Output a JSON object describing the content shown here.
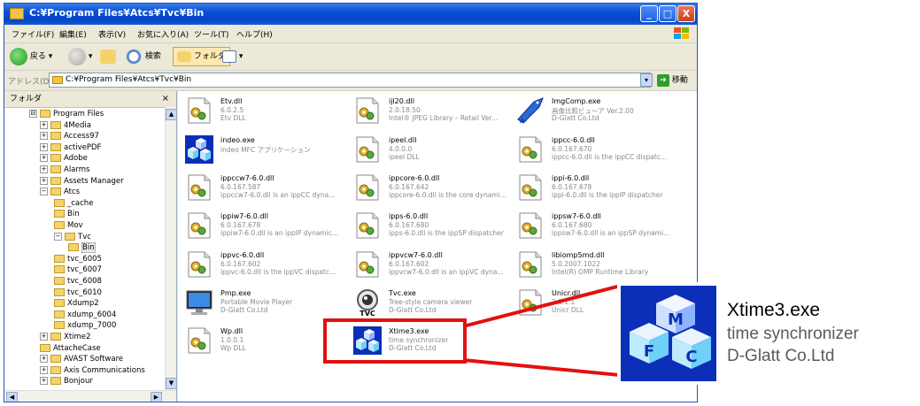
{
  "window": {
    "title": "C:¥Program Files¥Atcs¥Tvc¥Bin",
    "minimize": "_",
    "maximize": "□",
    "close": "X"
  },
  "menu": [
    "ファイル(F)",
    "編集(E)",
    "表示(V)",
    "お気に入り(A)",
    "ツール(T)",
    "ヘルプ(H)"
  ],
  "toolbar": {
    "back": "戻る",
    "search": "検索",
    "folders": "フォルダ"
  },
  "address": {
    "label": "アドレス(D)",
    "path": "C:¥Program Files¥Atcs¥Tvc¥Bin",
    "go": "移動"
  },
  "folder_pane": {
    "title": "フォルダ",
    "close": "×",
    "items": [
      {
        "label": "Program Files",
        "exp": "⊟"
      },
      {
        "label": "4Media",
        "exp": "+"
      },
      {
        "label": "Access97",
        "exp": "+"
      },
      {
        "label": "activePDF",
        "exp": "+"
      },
      {
        "label": "Adobe",
        "exp": "+"
      },
      {
        "label": "Alarms",
        "exp": "+"
      },
      {
        "label": "Assets Manager",
        "exp": "+"
      },
      {
        "label": "Atcs",
        "exp": "−"
      },
      {
        "label": "_cache",
        "exp": ""
      },
      {
        "label": "Bin",
        "exp": ""
      },
      {
        "label": "Mov",
        "exp": ""
      },
      {
        "label": "Tvc",
        "exp": "−"
      },
      {
        "label": "Bin",
        "exp": ""
      },
      {
        "label": "tvc_6005",
        "exp": ""
      },
      {
        "label": "tvc_6007",
        "exp": ""
      },
      {
        "label": "tvc_6008",
        "exp": ""
      },
      {
        "label": "tvc_6010",
        "exp": ""
      },
      {
        "label": "Xdump2",
        "exp": ""
      },
      {
        "label": "xdump_6004",
        "exp": ""
      },
      {
        "label": "xdump_7000",
        "exp": ""
      },
      {
        "label": "Xtime2",
        "exp": "+"
      },
      {
        "label": "AttacheCase",
        "exp": ""
      },
      {
        "label": "AVAST Software",
        "exp": "+"
      },
      {
        "label": "Axis Communications",
        "exp": "+"
      },
      {
        "label": "Bonjour",
        "exp": "+"
      }
    ]
  },
  "files": [
    {
      "name": "Etv.dll",
      "l2": "6.0.2.5",
      "l3": "Etv DLL",
      "icon": "dll-icon"
    },
    {
      "name": "ijl20.dll",
      "l2": "2.0.18.50",
      "l3": "Intel® JPEG Library – Retail Ver...",
      "icon": "dll-icon"
    },
    {
      "name": "ImgComp.exe",
      "l2": "画像比較ビューア Ver.2.00",
      "l3": "D-Glatt Co.Ltd",
      "icon": "fish-app-icon"
    },
    {
      "name": "indeo.exe",
      "l2": "indeo MFC アプリケーション",
      "l3": "",
      "icon": "cube-app-icon"
    },
    {
      "name": "ipeel.dll",
      "l2": "4.0.0.0",
      "l3": "ipeel DLL",
      "icon": "dll-icon"
    },
    {
      "name": "ippcc-6.0.dll",
      "l2": "6.0.167.670",
      "l3": "ippcc-6.0.dll is the ippCC dispatc...",
      "icon": "dll-icon"
    },
    {
      "name": "ippccw7-6.0.dll",
      "l2": "6.0.167.587",
      "l3": "ippccw7-6.0.dll is an ippCC dyna...",
      "icon": "dll-icon"
    },
    {
      "name": "ippcore-6.0.dll",
      "l2": "6.0.167.642",
      "l3": "ippcore-6.0.dll is the core dynami...",
      "icon": "dll-icon"
    },
    {
      "name": "ippi-6.0.dll",
      "l2": "6.0.167.678",
      "l3": "ippi-6.0.dll is the ippIP dispatcher",
      "icon": "dll-icon"
    },
    {
      "name": "ippiw7-6.0.dll",
      "l2": "6.0.167.678",
      "l3": "ippiw7-6.0.dll is an ippIP dynamic...",
      "icon": "dll-icon"
    },
    {
      "name": "ipps-6.0.dll",
      "l2": "6.0.167.680",
      "l3": "ipps-6.0.dll is the ippSP dispatcher",
      "icon": "dll-icon"
    },
    {
      "name": "ippsw7-6.0.dll",
      "l2": "6.0.167.680",
      "l3": "ippsw7-6.0.dll is an ippSP dynami...",
      "icon": "dll-icon"
    },
    {
      "name": "ippvc-6.0.dll",
      "l2": "6.0.167.602",
      "l3": "ippvc-6.0.dll is the ippVC dispatc...",
      "icon": "dll-icon"
    },
    {
      "name": "ippvcw7-6.0.dll",
      "l2": "6.0.167.602",
      "l3": "ippvcw7-6.0.dll is an ippVC dyna...",
      "icon": "dll-icon"
    },
    {
      "name": "libiomp5md.dll",
      "l2": "5.0.2007.1022",
      "l3": "Intel(R) OMP Runtime Library",
      "icon": "dll-icon"
    },
    {
      "name": "Pmp.exe",
      "l2": "Portable Movie Player",
      "l3": "D-Glatt Co.Ltd",
      "icon": "monitor-app-icon"
    },
    {
      "name": "Tvc.exe",
      "l2": "Tree-style camera viewer",
      "l3": "D-Glatt Co.Ltd",
      "icon": "camera-app-icon"
    },
    {
      "name": "Unicr.dll",
      "l2": "2.0.1.1",
      "l3": "Unicr DLL",
      "icon": "dll-icon"
    },
    {
      "name": "Wp.dll",
      "l2": "1.0.0.1",
      "l3": "Wp DLL",
      "icon": "dll-icon"
    },
    {
      "name": "Xtime3.exe",
      "l2": "time synchronizer",
      "l3": "D-Glatt Co.Ltd",
      "icon": "cube-app-icon"
    }
  ],
  "zoom": {
    "name": "Xtime3.exe",
    "description": "time synchronizer",
    "company": "D-Glatt Co.Ltd",
    "icon_letters": [
      "M",
      "F",
      "C"
    ],
    "highlight_color": "#e31010"
  }
}
